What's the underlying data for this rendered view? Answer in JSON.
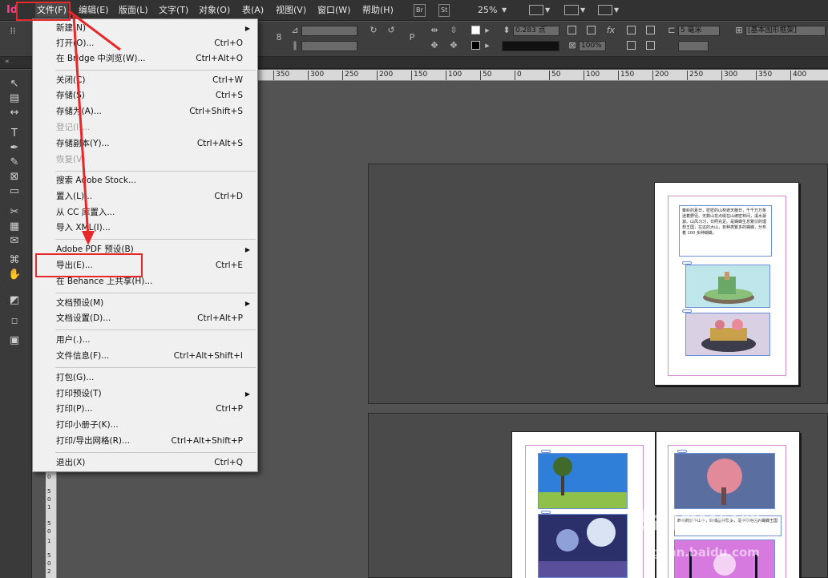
{
  "menubar": {
    "logo": "Id",
    "items": [
      "文件(F)",
      "编辑(E)",
      "版面(L)",
      "文字(T)",
      "对象(O)",
      "表(A)",
      "视图(V)",
      "窗口(W)",
      "帮助(H)"
    ],
    "bridge_chip": "Br",
    "stock_chip": "St",
    "zoom": "25%"
  },
  "controlbar": {
    "stroke_weight": "0.283 点",
    "scale_percent": "100%",
    "frame_offset": "5 毫米",
    "paragraph_style": "[基本图形框架]"
  },
  "rulers": {
    "horizontal": [
      "350",
      "300",
      "250",
      "200",
      "150",
      "100",
      "50",
      "0",
      "50",
      "100",
      "150",
      "200",
      "250",
      "300",
      "350",
      "400"
    ],
    "vertical": [
      "0",
      "5",
      "0",
      "1",
      "5",
      "0",
      "1",
      "5",
      "0",
      "2"
    ]
  },
  "file_menu": {
    "items": [
      {
        "label": "新建(N)",
        "shortcut": "",
        "submenu": true,
        "disabled": false
      },
      {
        "label": "打开(O)...",
        "shortcut": "Ctrl+O",
        "submenu": false,
        "disabled": false
      },
      {
        "label": "在 Bridge 中浏览(W)...",
        "shortcut": "Ctrl+Alt+O",
        "submenu": false,
        "disabled": false
      },
      {
        "label": "关闭(C)",
        "shortcut": "Ctrl+W",
        "submenu": false,
        "disabled": false
      },
      {
        "label": "存储(S)",
        "shortcut": "Ctrl+S",
        "submenu": false,
        "disabled": false
      },
      {
        "label": "存储为(A)...",
        "shortcut": "Ctrl+Shift+S",
        "submenu": false,
        "disabled": false
      },
      {
        "label": "登记(I)...",
        "shortcut": "",
        "submenu": false,
        "disabled": true
      },
      {
        "label": "存储副本(Y)...",
        "shortcut": "Ctrl+Alt+S",
        "submenu": false,
        "disabled": false
      },
      {
        "label": "恢复(V)",
        "shortcut": "",
        "submenu": false,
        "disabled": true
      },
      {
        "label": "搜索 Adobe Stock...",
        "shortcut": "",
        "submenu": false,
        "disabled": false
      },
      {
        "label": "置入(L)...",
        "shortcut": "Ctrl+D",
        "submenu": false,
        "disabled": false
      },
      {
        "label": "从 CC 库置入...",
        "shortcut": "",
        "submenu": false,
        "disabled": false
      },
      {
        "label": "导入 XML(I)...",
        "shortcut": "",
        "submenu": false,
        "disabled": false
      },
      {
        "label": "Adobe PDF 预设(B)",
        "shortcut": "",
        "submenu": true,
        "disabled": false
      },
      {
        "label": "导出(E)...",
        "shortcut": "Ctrl+E",
        "submenu": false,
        "disabled": false
      },
      {
        "label": "在 Behance 上共享(H)...",
        "shortcut": "",
        "submenu": false,
        "disabled": false
      },
      {
        "label": "文档预设(M)",
        "shortcut": "",
        "submenu": true,
        "disabled": false
      },
      {
        "label": "文档设置(D)...",
        "shortcut": "Ctrl+Alt+P",
        "submenu": false,
        "disabled": false
      },
      {
        "label": "用户(.)...",
        "shortcut": "",
        "submenu": false,
        "disabled": false
      },
      {
        "label": "文件信息(F)...",
        "shortcut": "Ctrl+Alt+Shift+I",
        "submenu": false,
        "disabled": false
      },
      {
        "label": "打包(G)...",
        "shortcut": "",
        "submenu": false,
        "disabled": false
      },
      {
        "label": "打印预设(T)",
        "shortcut": "",
        "submenu": true,
        "disabled": false
      },
      {
        "label": "打印(P)...",
        "shortcut": "Ctrl+P",
        "submenu": false,
        "disabled": false
      },
      {
        "label": "打印小册子(K)...",
        "shortcut": "",
        "submenu": false,
        "disabled": false
      },
      {
        "label": "打印/导出网格(R)...",
        "shortcut": "Ctrl+Alt+Shift+P",
        "submenu": false,
        "disabled": false
      },
      {
        "label": "退出(X)",
        "shortcut": "Ctrl+Q",
        "submenu": false,
        "disabled": false
      }
    ]
  },
  "document": {
    "page1_text": "秦岭的夏日，密密的山林遮天蔽日，千千万万条迷着野径。无数山花点缀在山坡密林间，溪水潺潺。山风习习，日照充足。是蝴蝶生息繁衍的理想王国，在这的大山，有种类繁多的蝴蝶，分布着 100 多种蝴蝶。",
    "page3_text": "西峡的伏牛山中，蝴蝶品种繁多，是中原地区的蝴蝶王国"
  },
  "watermark": {
    "brand": "Baidu",
    "brand_cn": "经验",
    "url": "jingyan.baidu.com"
  },
  "colors": {
    "accent_red": "#e8272a",
    "app_pink": "#ff3c8e",
    "frame_blue": "#6c8fd6",
    "margin_magenta": "#d48ecf"
  }
}
